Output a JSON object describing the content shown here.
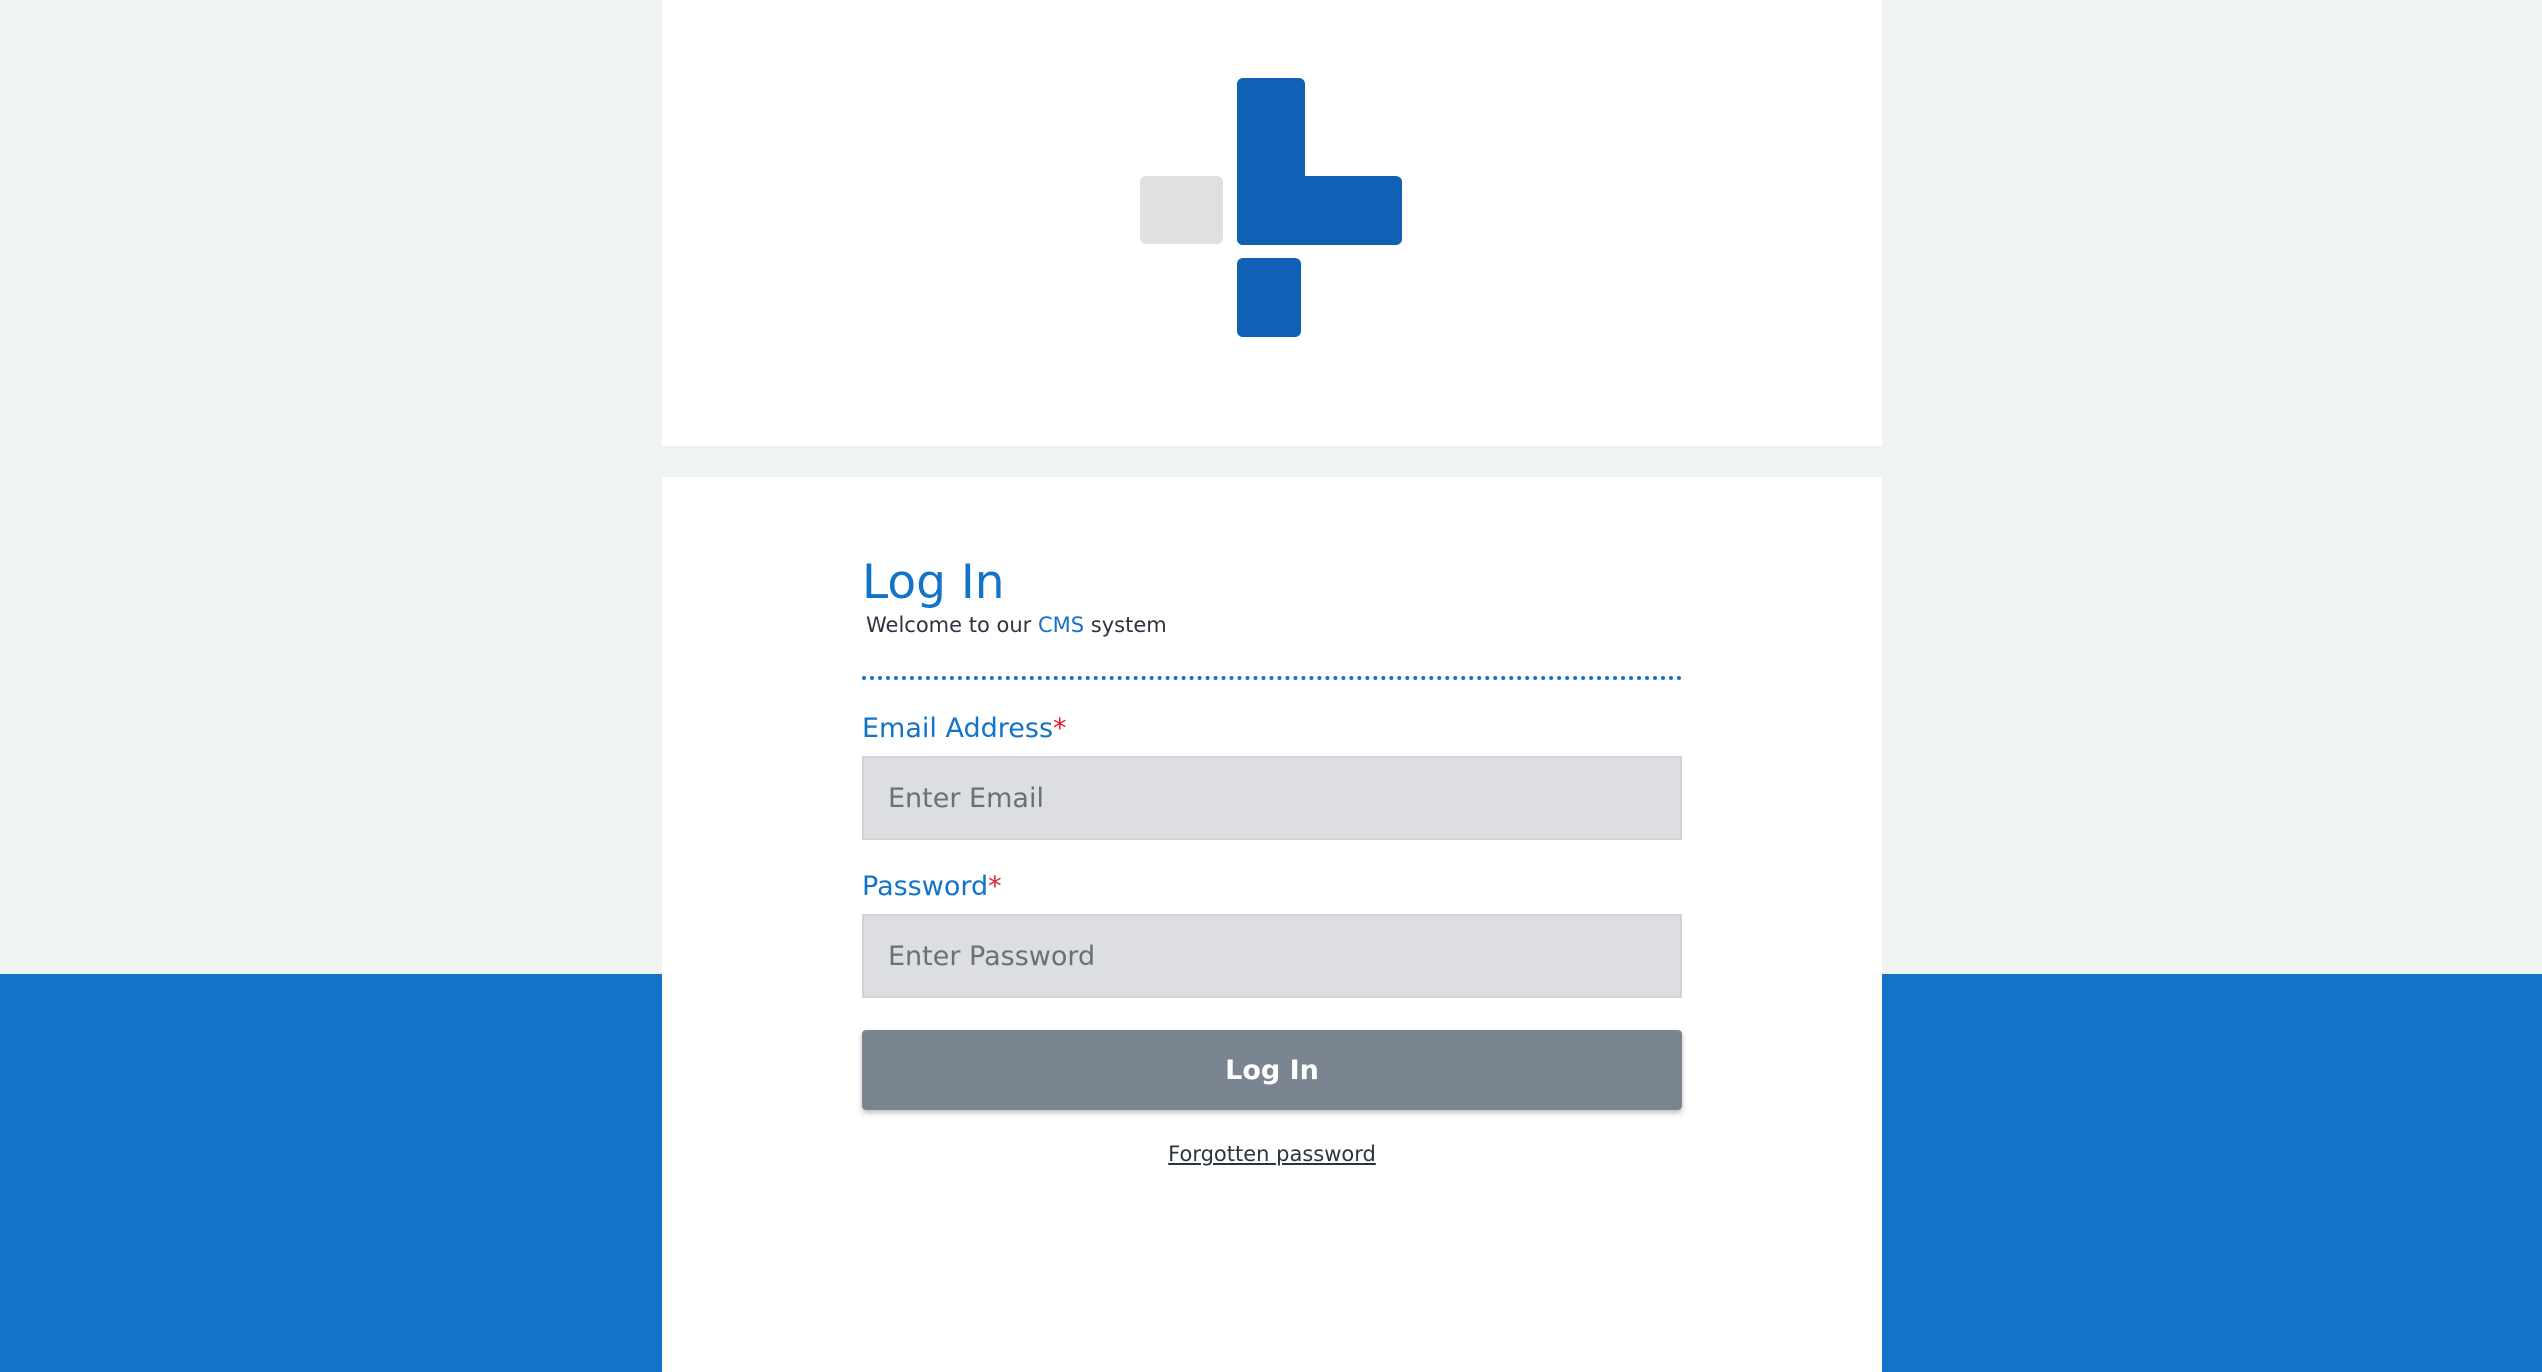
{
  "colors": {
    "page_background": "#f0f3f4",
    "brand_blue": "#1273c8",
    "logo_blue": "#1061b5",
    "logo_grey": "#e0e0e0",
    "panel_background": "#ffffff",
    "input_background": "#dcdee1",
    "button_background": "#7a8591",
    "required_marker": "#e0202c"
  },
  "logo": {
    "icon": "plus-shaped-logo-icon"
  },
  "login": {
    "title": "Log In",
    "welcome_prefix": "Welcome to our",
    "welcome_highlight": "CMS",
    "welcome_suffix": "system",
    "email_label": "Email Address",
    "email_placeholder": "Enter Email",
    "email_value": "",
    "password_label": "Password",
    "password_placeholder": "Enter Password",
    "password_value": "",
    "required_marker": "*",
    "submit_label": "Log In",
    "forgot_label": "Forgotten password"
  }
}
